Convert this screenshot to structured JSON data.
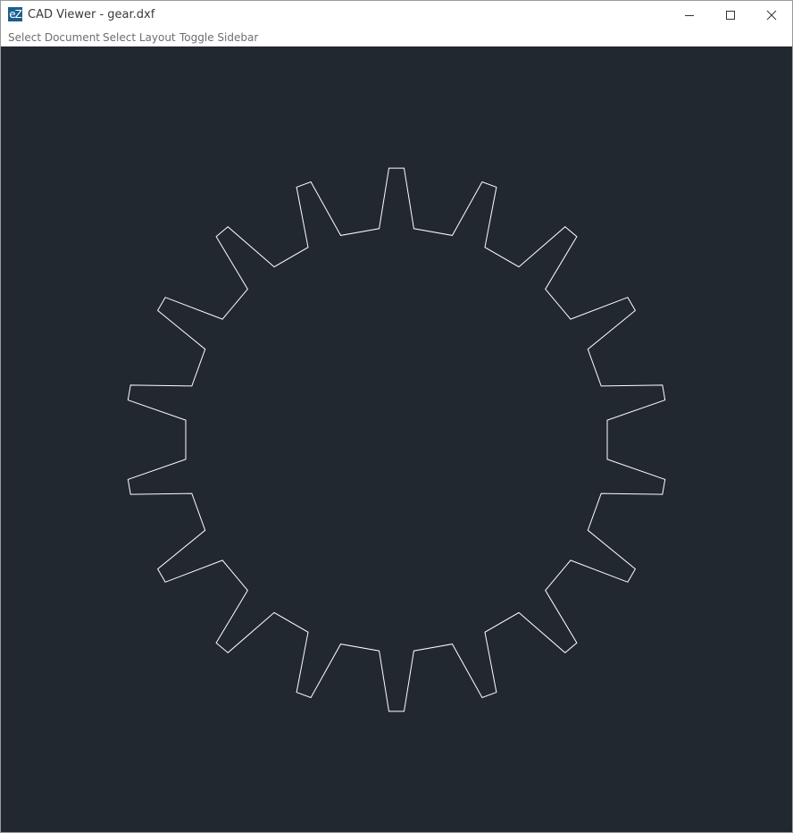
{
  "window": {
    "icon_text": "eZ",
    "title": "CAD Viewer - gear.dxf"
  },
  "menu": {
    "items": [
      "Select Document",
      "Select Layout",
      "Toggle Sidebar"
    ]
  },
  "viewport": {
    "background_color": "#212830",
    "stroke_color": "#ffffff",
    "drawing": {
      "type": "gear-outline",
      "teeth": 18
    }
  },
  "icons": {
    "minimize": "minimize-icon",
    "maximize": "maximize-icon",
    "close": "close-icon"
  }
}
